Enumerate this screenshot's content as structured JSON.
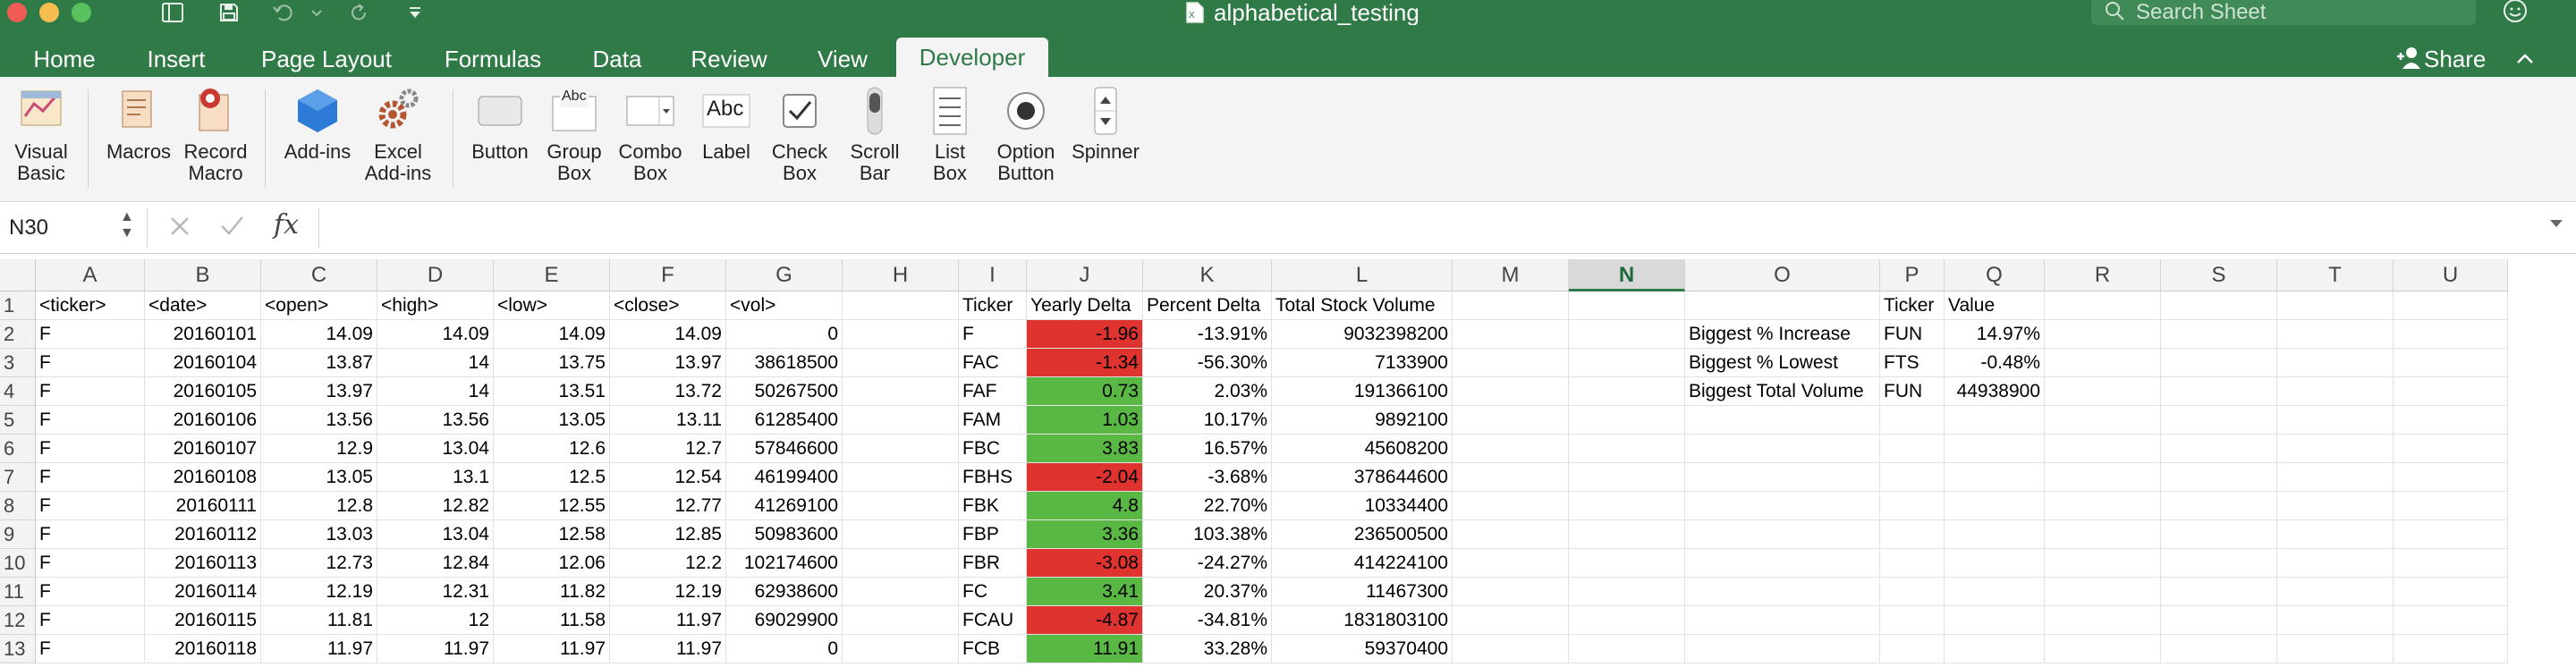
{
  "window": {
    "title": "alphabetical_testing",
    "search_placeholder": "Search Sheet"
  },
  "tabs": [
    "Home",
    "Insert",
    "Page Layout",
    "Formulas",
    "Data",
    "Review",
    "View",
    "Developer"
  ],
  "active_tab": "Developer",
  "share_label": "Share",
  "ribbon": {
    "visual_basic": "Visual\nBasic",
    "macros": "Macros",
    "record_macro": "Record\nMacro",
    "addins": "Add-ins",
    "excel_addins": "Excel\nAdd-ins",
    "button": "Button",
    "group_box": "Group\nBox",
    "combo_box": "Combo\nBox",
    "label": "Label",
    "check_box": "Check\nBox",
    "scroll_bar": "Scroll\nBar",
    "list_box": "List\nBox",
    "option_button": "Option\nButton",
    "spinner": "Spinner",
    "group_box_icon_text": "Abc",
    "label_icon_text": "Abc"
  },
  "formula_bar": {
    "name_box": "N30",
    "fx": "fx",
    "value": ""
  },
  "columns": [
    "A",
    "B",
    "C",
    "D",
    "E",
    "F",
    "G",
    "H",
    "I",
    "J",
    "K",
    "L",
    "M",
    "N",
    "O",
    "P",
    "Q",
    "R",
    "S",
    "T",
    "U"
  ],
  "selected_column": "N",
  "rows": [
    "1",
    "2",
    "3",
    "4",
    "5",
    "6",
    "7",
    "8",
    "9",
    "10",
    "11",
    "12",
    "13"
  ],
  "sheet": {
    "A": [
      "<ticker>",
      "F",
      "F",
      "F",
      "F",
      "F",
      "F",
      "F",
      "F",
      "F",
      "F",
      "F",
      "F"
    ],
    "B": [
      "<date>",
      "20160101",
      "20160104",
      "20160105",
      "20160106",
      "20160107",
      "20160108",
      "20160111",
      "20160112",
      "20160113",
      "20160114",
      "20160115",
      "20160118"
    ],
    "C": [
      "<open>",
      "14.09",
      "13.87",
      "13.97",
      "13.56",
      "12.9",
      "13.05",
      "12.8",
      "13.03",
      "12.73",
      "12.19",
      "11.81",
      "11.97"
    ],
    "D": [
      "<high>",
      "14.09",
      "14",
      "14",
      "13.56",
      "13.04",
      "13.1",
      "12.82",
      "13.04",
      "12.84",
      "12.31",
      "12",
      "11.97"
    ],
    "E": [
      "<low>",
      "14.09",
      "13.75",
      "13.51",
      "13.05",
      "12.6",
      "12.5",
      "12.55",
      "12.58",
      "12.06",
      "11.82",
      "11.58",
      "11.97"
    ],
    "F": [
      "<close>",
      "14.09",
      "13.97",
      "13.72",
      "13.11",
      "12.7",
      "12.54",
      "12.77",
      "12.85",
      "12.2",
      "12.19",
      "11.97",
      "11.97"
    ],
    "G": [
      "<vol>",
      "0",
      "38618500",
      "50267500",
      "61285400",
      "57846600",
      "46199400",
      "41269100",
      "50983600",
      "102174600",
      "62938600",
      "69029900",
      "0"
    ],
    "I": [
      "Ticker",
      "F",
      "FAC",
      "FAF",
      "FAM",
      "FBC",
      "FBHS",
      "FBK",
      "FBP",
      "FBR",
      "FC",
      "FCAU",
      "FCB"
    ],
    "J": [
      "Yearly Delta",
      "-1.96",
      "-1.34",
      "0.73",
      "1.03",
      "3.83",
      "-2.04",
      "4.8",
      "3.36",
      "-3.08",
      "3.41",
      "-4.87",
      "11.91"
    ],
    "K": [
      "Percent Delta",
      "-13.91%",
      "-56.30%",
      "2.03%",
      "10.17%",
      "16.57%",
      "-3.68%",
      "22.70%",
      "103.38%",
      "-24.27%",
      "20.37%",
      "-34.81%",
      "33.28%"
    ],
    "L": [
      "Total Stock Volume",
      "9032398200",
      "7133900",
      "191366100",
      "9892100",
      "45608200",
      "378644600",
      "10334400",
      "236500500",
      "414224100",
      "11467300",
      "1831803100",
      "59370400"
    ],
    "O": [
      "",
      "Biggest % Increase",
      "Biggest % Lowest",
      "Biggest Total Volume",
      "",
      "",
      "",
      "",
      "",
      "",
      "",
      "",
      ""
    ],
    "P": [
      "Ticker",
      "FUN",
      "FTS",
      "FUN",
      "",
      "",
      "",
      "",
      "",
      "",
      "",
      "",
      ""
    ],
    "Q": [
      "Value",
      "14.97%",
      "-0.48%",
      "44938900",
      "",
      "",
      "",
      "",
      "",
      "",
      "",
      "",
      ""
    ]
  },
  "colors": {
    "accent": "#2f7a47",
    "negative_fill": "#df3330",
    "positive_fill": "#59b843"
  }
}
